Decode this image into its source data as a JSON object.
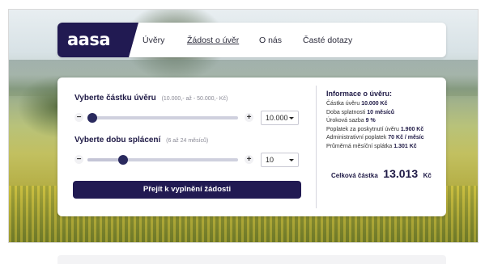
{
  "brand": {
    "logo_text": "aasa",
    "accent_color": "#211a52"
  },
  "nav": {
    "items": [
      {
        "label": "Úvěry",
        "active": false
      },
      {
        "label": "Žádost o úvěr",
        "active": true
      },
      {
        "label": "O nás",
        "active": false
      },
      {
        "label": "Časté dotazy",
        "active": false
      }
    ]
  },
  "loan_amount": {
    "title": "Vyberte částku úvěru",
    "hint": "(10.000,- až - 50.000,- Kč)",
    "minus_label": "−",
    "plus_label": "+",
    "selected_value": "10.000",
    "slider_fraction": 0.0
  },
  "repayment_period": {
    "title": "Vyberte dobu splácení",
    "hint": "(6 až 24 měsíců)",
    "minus_label": "−",
    "plus_label": "+",
    "selected_value": "10",
    "slider_fraction": 0.22
  },
  "cta": {
    "label": "Přejít k vyplnění žádosti"
  },
  "info": {
    "title": "Informace o úvěru:",
    "rows": [
      {
        "label": "Částka úvěru",
        "value": "10.000 Kč"
      },
      {
        "label": "Doba splatnosti",
        "value": "10 měsíců"
      },
      {
        "label": "Úroková sazba",
        "value": "9 %"
      },
      {
        "label": "Poplatek za poskytnutí úvěru",
        "value": "1.900 Kč"
      },
      {
        "label": "Administrativní poplatek",
        "value": "70 Kč / měsíc"
      },
      {
        "label": "Průměrná měsíční splátka",
        "value": "1.301 Kč"
      }
    ],
    "total_label": "Celková částka",
    "total_amount": "13.013",
    "total_currency": "Kč"
  }
}
